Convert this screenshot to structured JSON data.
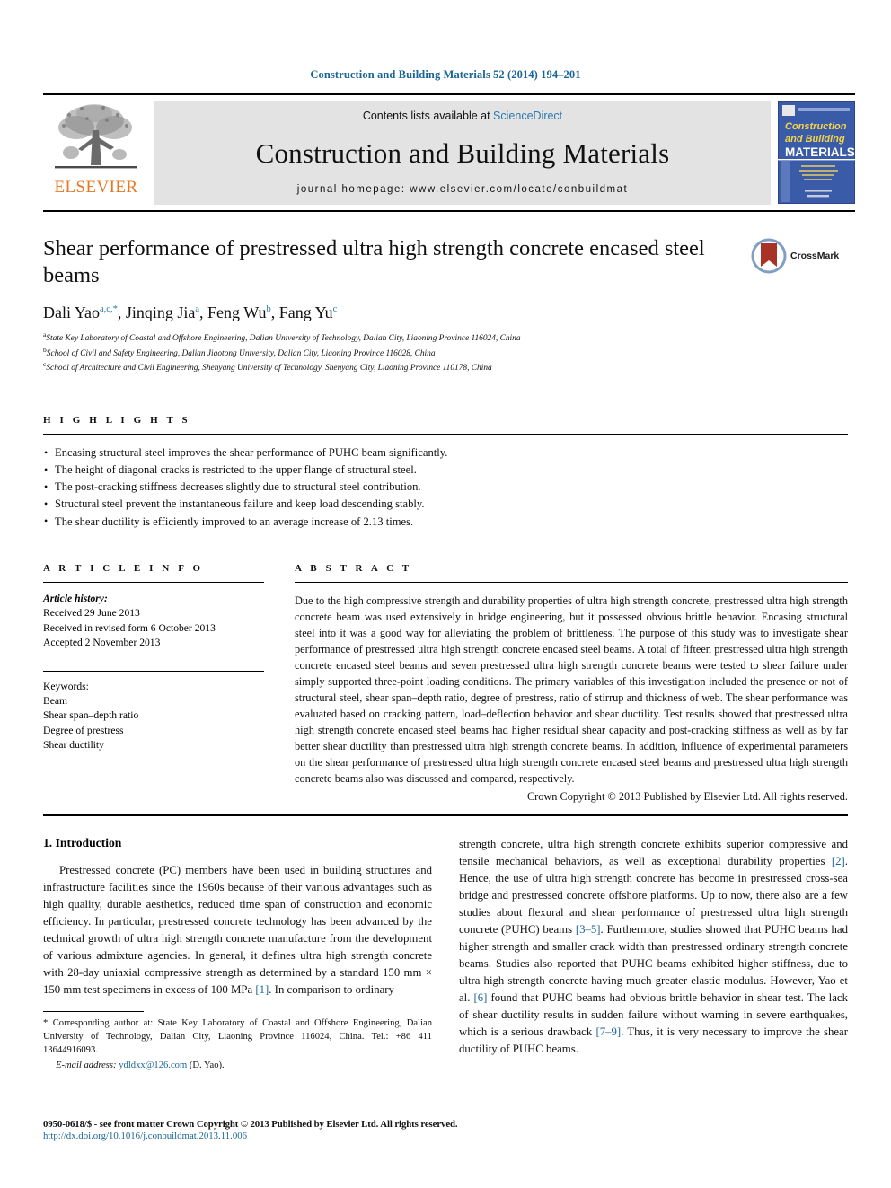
{
  "running_head": "Construction and Building Materials 52 (2014) 194–201",
  "masthead": {
    "publisher_name": "ELSEVIER",
    "contents_prefix": "Contents lists available at ",
    "sciencedirect": "ScienceDirect",
    "journal_name": "Construction and Building Materials",
    "homepage": "journal homepage: www.elsevier.com/locate/conbuildmat",
    "cover": {
      "line1": "Construction",
      "line2": "and Building",
      "line3": "MATERIALS"
    }
  },
  "article": {
    "title": "Shear performance of prestressed ultra high strength concrete encased steel beams",
    "crossmark_label": "CrossMark",
    "authors": [
      {
        "name": "Dali Yao",
        "marks": "a,c,*"
      },
      {
        "name": "Jinqing Jia",
        "marks": "a"
      },
      {
        "name": "Feng Wu",
        "marks": "b"
      },
      {
        "name": "Fang Yu",
        "marks": "c"
      }
    ],
    "affiliations": [
      {
        "mark": "a",
        "text": "State Key Laboratory of Coastal and Offshore Engineering, Dalian University of Technology, Dalian City, Liaoning Province 116024, China"
      },
      {
        "mark": "b",
        "text": "School of Civil and Safety Engineering, Dalian Jiaotong University, Dalian City, Liaoning Province 116028, China"
      },
      {
        "mark": "c",
        "text": "School of Architecture and Civil Engineering, Shenyang University of Technology, Shenyang City, Liaoning Province 110178, China"
      }
    ]
  },
  "highlights": {
    "heading": "H I G H L I G H T S",
    "items": [
      "Encasing structural steel improves the shear performance of PUHC beam significantly.",
      "The height of diagonal cracks is restricted to the upper flange of structural steel.",
      "The post-cracking stiffness decreases slightly due to structural steel contribution.",
      "Structural steel prevent the instantaneous failure and keep load descending stably.",
      "The shear ductility is efficiently improved to an average increase of 2.13 times."
    ]
  },
  "article_info": {
    "heading": "A R T I C L E    I N F O",
    "history_label": "Article history:",
    "history": [
      "Received 29 June 2013",
      "Received in revised form 6 October 2013",
      "Accepted 2 November 2013"
    ],
    "keywords_label": "Keywords:",
    "keywords": [
      "Beam",
      "Shear span–depth ratio",
      "Degree of prestress",
      "Shear ductility"
    ]
  },
  "abstract": {
    "heading": "A B S T R A C T",
    "text": "Due to the high compressive strength and durability properties of ultra high strength concrete, prestressed ultra high strength concrete beam was used extensively in bridge engineering, but it possessed obvious brittle behavior. Encasing structural steel into it was a good way for alleviating the problem of brittleness. The purpose of this study was to investigate shear performance of prestressed ultra high strength concrete encased steel beams. A total of fifteen prestressed ultra high strength concrete encased steel beams and seven prestressed ultra high strength concrete beams were tested to shear failure under simply supported three-point loading conditions. The primary variables of this investigation included the presence or not of structural steel, shear span–depth ratio, degree of prestress, ratio of stirrup and thickness of web. The shear performance was evaluated based on cracking pattern, load–deflection behavior and shear ductility. Test results showed that prestressed ultra high strength concrete encased steel beams had higher residual shear capacity and post-cracking stiffness as well as by far better shear ductility than prestressed ultra high strength concrete beams. In addition, influence of experimental parameters on the shear performance of prestressed ultra high strength concrete encased steel beams and prestressed ultra high strength concrete beams also was discussed and compared, respectively.",
    "copyright": "Crown Copyright © 2013 Published by Elsevier Ltd. All rights reserved."
  },
  "introduction": {
    "heading": "1. Introduction",
    "left_paragraph_part1": "Prestressed concrete (PC) members have been used in building structures and infrastructure facilities since the 1960s because of their various advantages such as high quality, durable aesthetics, reduced time span of construction and economic efficiency. In particular, prestressed concrete technology has been advanced by the technical growth of ultra high strength concrete manufacture from the development of various admixture agencies. In general, it defines ultra high strength concrete with 28-day uniaxial compressive strength as determined by a standard 150 mm × 150 mm test specimens in excess of 100 MPa ",
    "ref1": "[1]",
    "left_paragraph_part2": ". In comparison to ordinary",
    "right_p1_a": "strength concrete, ultra high strength concrete exhibits superior compressive and tensile mechanical behaviors, as well as exceptional durability properties ",
    "right_ref2": "[2]",
    "right_p1_b": ". Hence, the use of ultra high strength concrete has become in prestressed cross-sea bridge and prestressed concrete offshore platforms. Up to now, there also are a few studies about flexural and shear performance of prestressed ultra high strength concrete (PUHC) beams ",
    "right_ref35": "[3–5]",
    "right_p1_c": ". Furthermore, studies showed that PUHC beams had higher strength and smaller crack width than prestressed ordinary strength concrete beams. Studies also reported that PUHC beams exhibited higher stiffness, due to ultra high strength concrete having much greater elastic modulus. However, Yao et al. ",
    "right_ref6": "[6]",
    "right_p1_d": " found that PUHC beams had obvious brittle behavior in shear test. The lack of shear ductility results in sudden failure without warning in severe earthquakes, which is a serious drawback ",
    "right_ref79": "[7–9]",
    "right_p1_e": ". Thus, it is very necessary to improve the shear ductility of PUHC beams."
  },
  "footnote": {
    "corresponding": "* Corresponding author at: State Key Laboratory of Coastal and Offshore Engineering, Dalian University of Technology, Dalian City, Liaoning Province 116024, China. Tel.: +86 411 13644916093.",
    "email_label": "E-mail address:",
    "email": "ydldxx@126.com",
    "email_suffix": "(D. Yao)."
  },
  "page_footer": {
    "issn_line": "0950-0618/$ - see front matter Crown Copyright © 2013 Published by Elsevier Ltd. All rights reserved.",
    "doi": "http://dx.doi.org/10.1016/j.conbuildmat.2013.11.006"
  },
  "colors": {
    "link_blue": "#1a6496",
    "elsevier_orange": "#e87722",
    "sciencedirect_blue": "#2a7ab0",
    "cover_blue": "#3a5ba8",
    "crossmark_red": "#a93226"
  }
}
